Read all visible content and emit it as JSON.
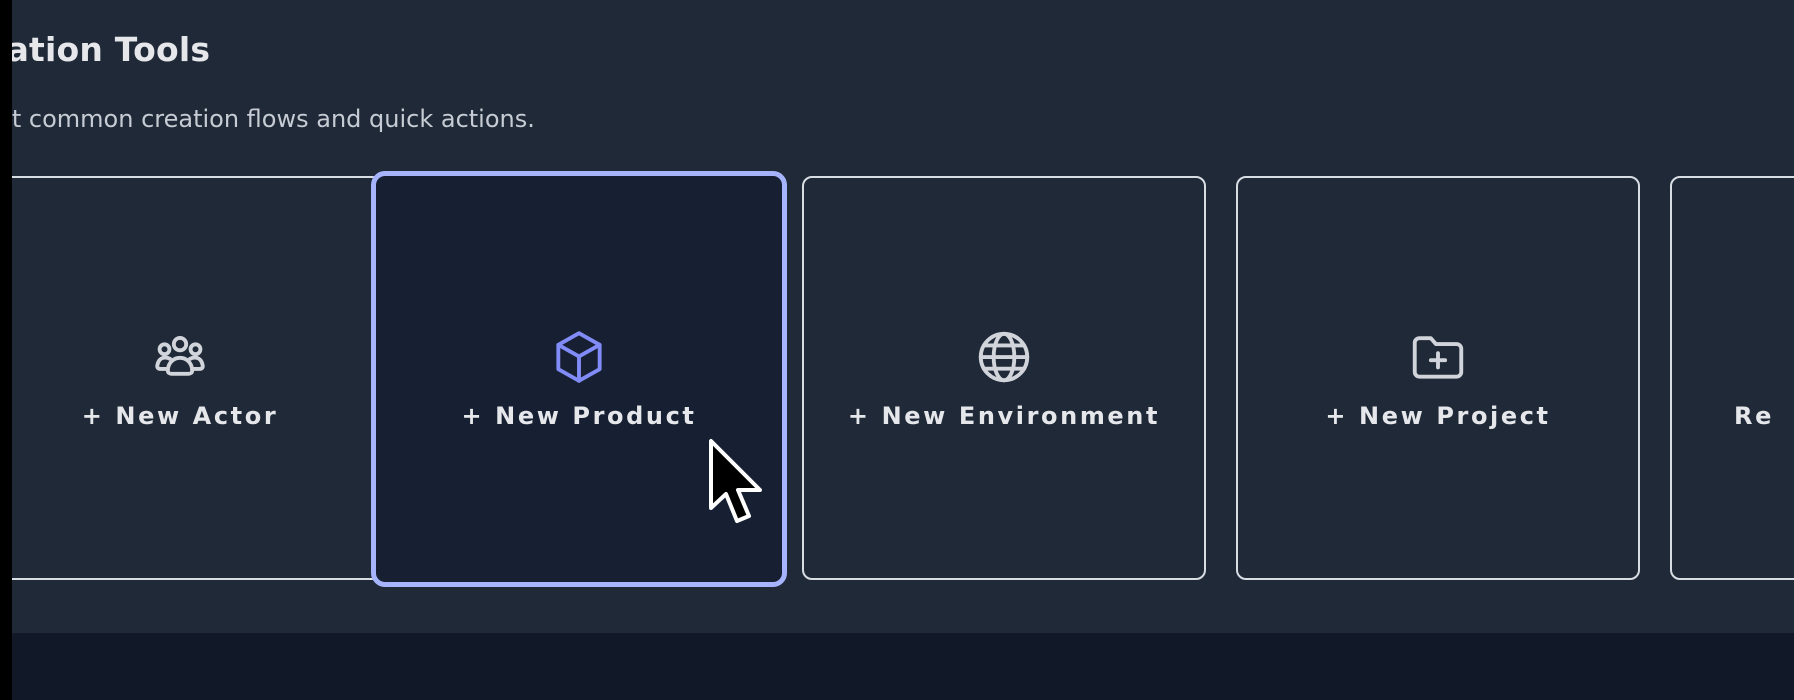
{
  "panel": {
    "title": "eation Tools",
    "subtitle": "rt common creation flows and quick actions."
  },
  "cards": [
    {
      "label": "+ New Actor",
      "icon": "users-icon",
      "active": false
    },
    {
      "label": "+ New Product",
      "icon": "cube-icon",
      "active": true
    },
    {
      "label": "+ New Environment",
      "icon": "globe-icon",
      "active": false
    },
    {
      "label": "+ New Project",
      "icon": "folder-plus-icon",
      "active": false
    },
    {
      "label": "Re",
      "icon": "",
      "active": false
    }
  ],
  "colors": {
    "panel_bg": "#1f2937",
    "page_bg": "#111827",
    "card_border": "#d8dce3",
    "active_border": "#a5b4fc",
    "active_icon": "#818cf8",
    "text": "#e5e7eb"
  }
}
